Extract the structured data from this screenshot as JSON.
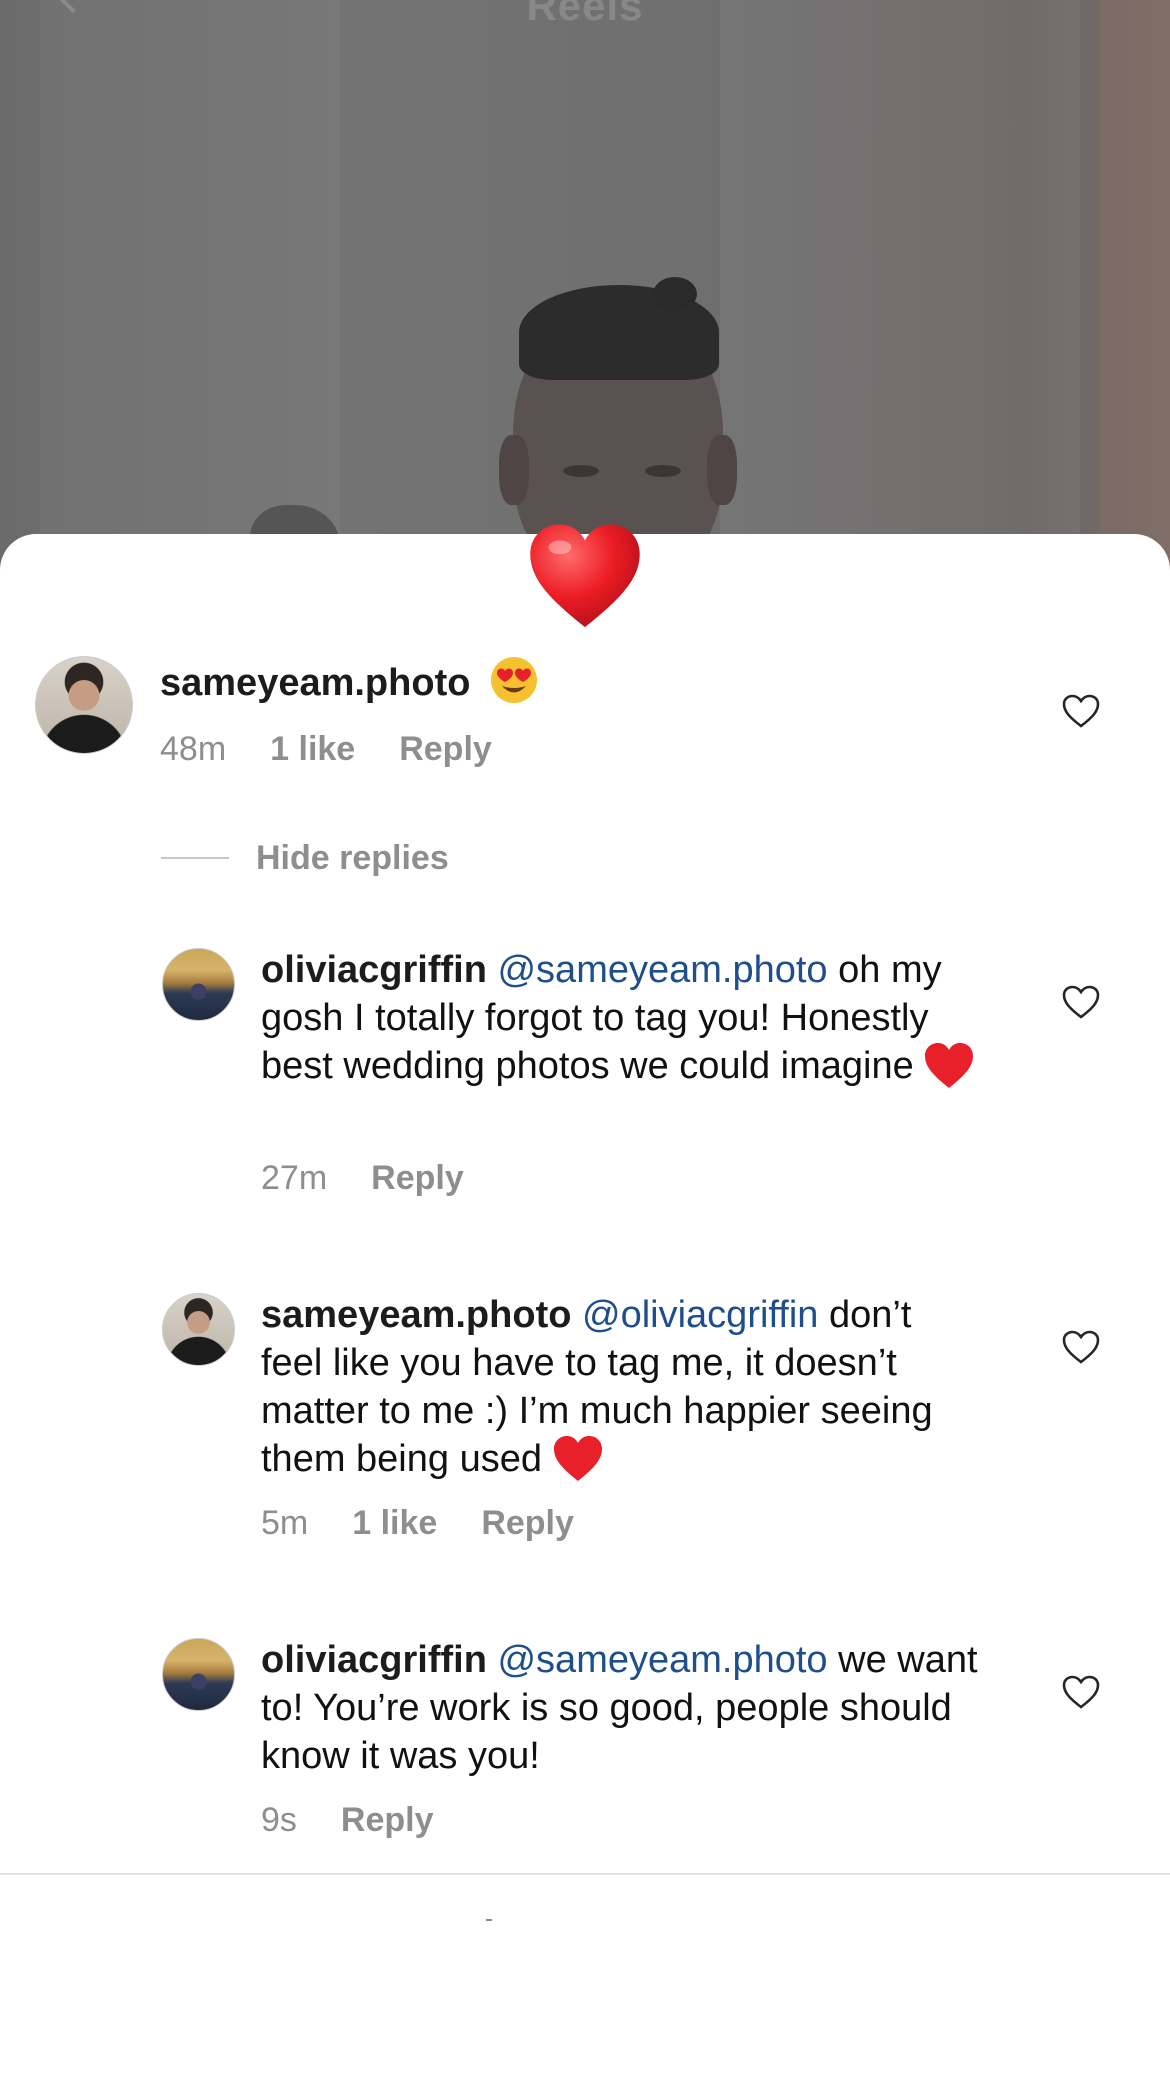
{
  "header": {
    "title": "Reels"
  },
  "reaction_emoji": "heart-emoji",
  "comment": {
    "username": "sameyeam.photo",
    "emoji": "heart-eyes-emoji",
    "time": "48m",
    "likes": "1 like",
    "reply_label": "Reply"
  },
  "hide_replies_label": "Hide replies",
  "replies": [
    {
      "username": "oliviacgriffin",
      "mention": "@sameyeam.photo",
      "text": "oh my gosh I totally forgot to tag you! Honestly best wedding photos we could imagine",
      "emoji": "red-heart-emoji",
      "time": "27m",
      "likes": "",
      "reply_label": "Reply"
    },
    {
      "username": "sameyeam.photo",
      "mention": "@oliviacgriffin",
      "text": "don’t feel like you have to tag me, it doesn’t matter to me :) I’m much happier seeing them being used",
      "emoji": "red-heart-emoji",
      "time": "5m",
      "likes": "1 like",
      "reply_label": "Reply"
    },
    {
      "username": "oliviacgriffin",
      "mention": "@sameyeam.photo",
      "text": "we want to! You’re work is so good, people should know it was you!",
      "emoji": "",
      "time": "9s",
      "likes": "",
      "reply_label": "Reply"
    }
  ],
  "colors": {
    "mention": "#1f4f8a",
    "meta": "#8e8e8e",
    "heart": "#e8202a"
  }
}
